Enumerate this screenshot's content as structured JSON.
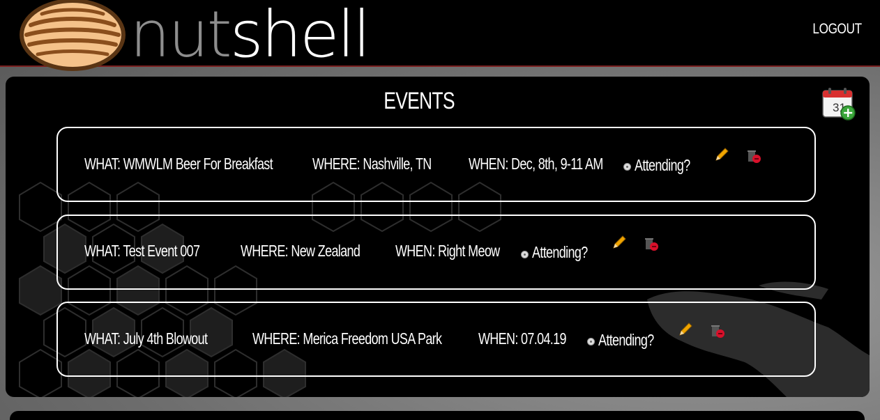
{
  "header": {
    "logo_text_nut": "nut",
    "logo_text_shell": "shell",
    "logout_label": "LOGOUT"
  },
  "events_panel": {
    "title": "EVENTS",
    "add_icon_day": "31"
  },
  "events": [
    {
      "what": "WHAT: WMWLM Beer For Breakfast",
      "where": "WHERE: Nashville, TN",
      "when": "WHEN: Dec, 8th, 9-11 AM",
      "attending_label": "Attending?"
    },
    {
      "what": "WHAT: Test Event 007",
      "where": "WHERE: New Zealand",
      "when": "WHEN: Right Meow",
      "attending_label": "Attending?"
    },
    {
      "what": "WHAT: July 4th Blowout",
      "where": "WHERE: Merica Freedom USA Park",
      "when": "WHEN: 07.04.19",
      "attending_label": "Attending?"
    }
  ],
  "colors": {
    "header_bg": "#000000",
    "header_border": "#7a1f1f",
    "panel_bg": "#000000",
    "text": "#ffffff",
    "logo_nut": "#8e8e8e",
    "nut_fill": "#f5c28a",
    "edit_icon": "#f0a500",
    "delete_badge": "#d8102a",
    "add_badge": "#3aa63a"
  }
}
